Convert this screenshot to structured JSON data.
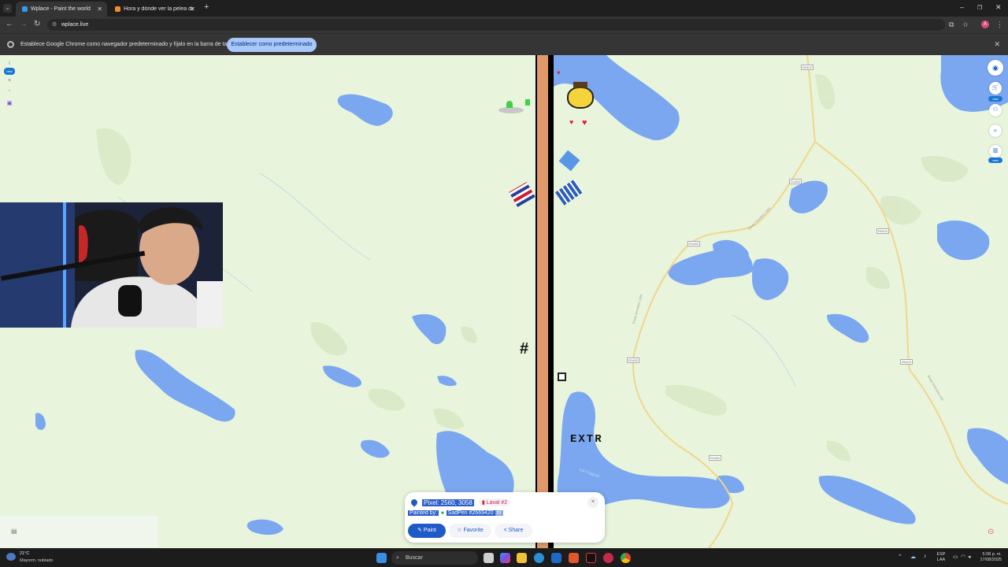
{
  "browser": {
    "tabs": [
      {
        "title": "Wplace - Paint the world",
        "active": true,
        "favicon_color": "#2a9df4"
      },
      {
        "title": "Hora y dónde ver la pelea de W",
        "active": false,
        "favicon_color": "#f28c28"
      }
    ],
    "url": "wplace.live",
    "infobar": {
      "message": "Establece Google Chrome como navegador predeterminado y fíjalo en la barra de tareas",
      "button": "Establecer como predeterminado"
    },
    "avatar_letter": "A"
  },
  "map": {
    "road_labels": [
      "R0403",
      "R1450",
      "R1450",
      "R0403",
      "R1450",
      "R0403",
      "R1450",
      "R1450"
    ],
    "route_labels": [
      "Route forestière 1450",
      "Route forestière 1450",
      "Route forestière 403"
    ],
    "lake_label": "Lac Cagnes",
    "art_text": "EXTR",
    "left_new": "new",
    "right_new_1": "new",
    "right_new_2": "new"
  },
  "pixel_panel": {
    "pixel_label": "Pixel: 2560, 3058",
    "location": "Laval #2",
    "painted_by_label": "Painted by:",
    "painter": "SadPen #2669420",
    "painter_suffix": "m",
    "paint_button": "Paint",
    "favorite_button": "Favorite",
    "share_button": "Share",
    "close_glyph": "×"
  },
  "taskbar": {
    "weather_temp": "21°C",
    "weather_desc": "Mayorm. nublado",
    "search_placeholder": "Buscar",
    "lang_top": "ESP",
    "lang_bottom": "LAA",
    "time": "5:08 p. m.",
    "date": "17/08/2025"
  },
  "colors": {
    "accent": "#1e5bc6",
    "map_land": "#e8f5dc",
    "water": "#7aa7f0",
    "stripe_orange": "#e0996a"
  }
}
